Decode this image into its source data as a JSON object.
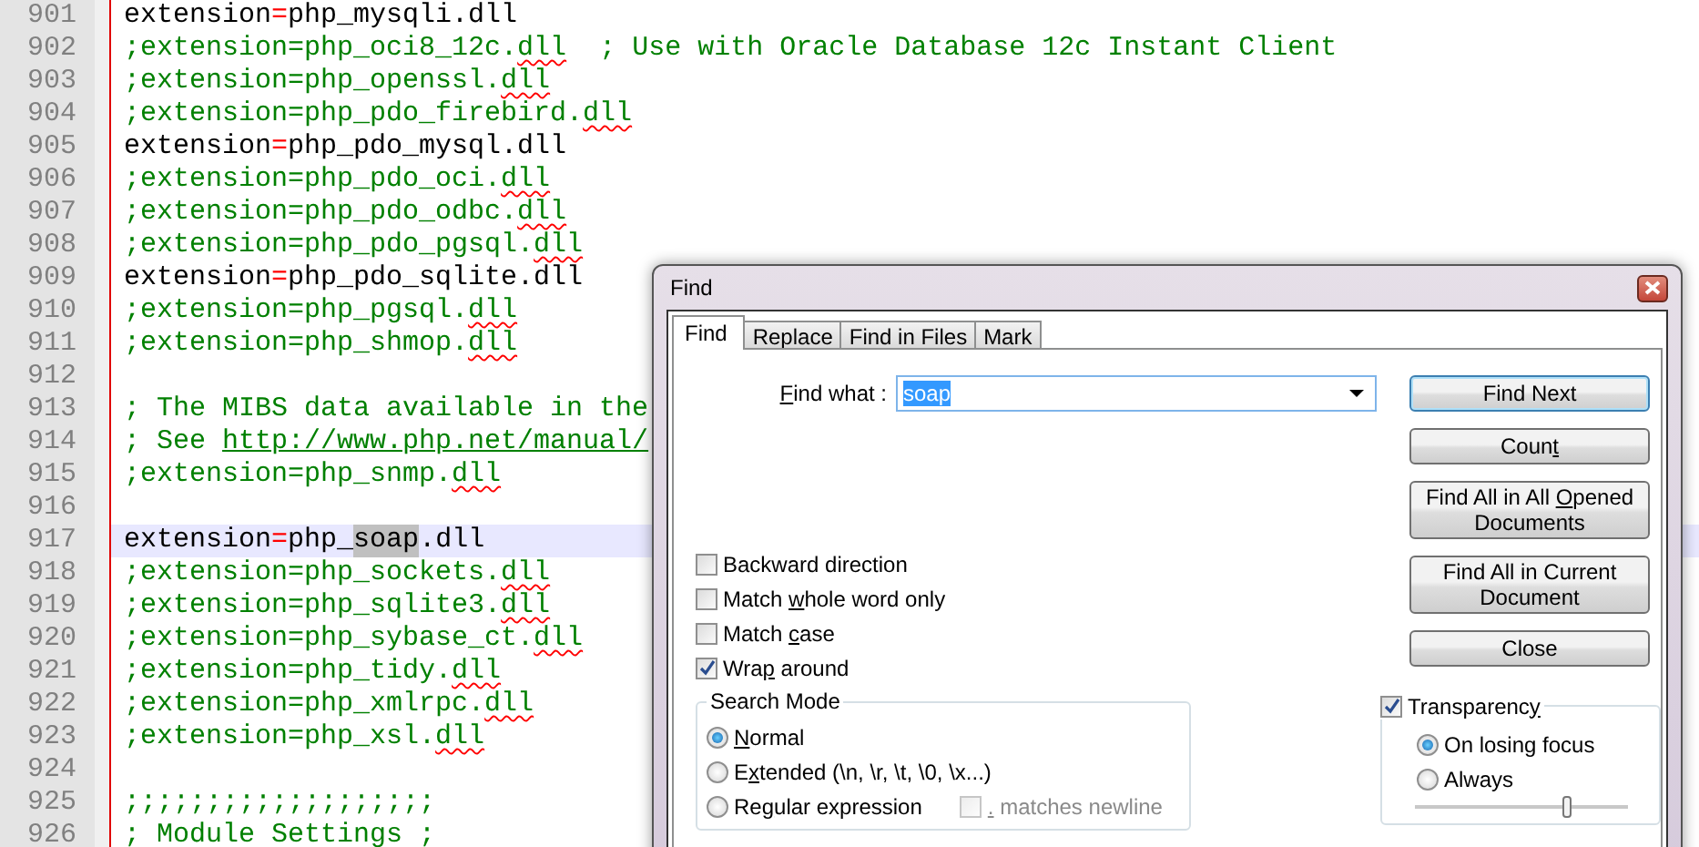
{
  "editor": {
    "lines": [
      {
        "number": "901",
        "kind": "directive",
        "current": false,
        "parts": [
          {
            "text": "extension",
            "kind": "plain"
          },
          {
            "text": "=",
            "kind": "operator"
          },
          {
            "text": "php_mysqli.dll",
            "kind": "plain"
          }
        ]
      },
      {
        "number": "902",
        "kind": "comment",
        "current": false,
        "parts": [
          {
            "text": ";extension=php_oci8_12c.",
            "kind": "plain"
          },
          {
            "text": "dll",
            "kind": "misspelled"
          },
          {
            "text": "  ; Use with Oracle Database 12c Instant Client",
            "kind": "plain"
          }
        ]
      },
      {
        "number": "903",
        "kind": "comment",
        "current": false,
        "parts": [
          {
            "text": ";extension=php_openssl.",
            "kind": "plain"
          },
          {
            "text": "dll",
            "kind": "misspelled"
          }
        ]
      },
      {
        "number": "904",
        "kind": "comment",
        "current": false,
        "parts": [
          {
            "text": ";extension=php_pdo_firebird.",
            "kind": "plain"
          },
          {
            "text": "dll",
            "kind": "misspelled"
          }
        ]
      },
      {
        "number": "905",
        "kind": "directive",
        "current": false,
        "parts": [
          {
            "text": "extension",
            "kind": "plain"
          },
          {
            "text": "=",
            "kind": "operator"
          },
          {
            "text": "php_pdo_mysql.dll",
            "kind": "plain"
          }
        ]
      },
      {
        "number": "906",
        "kind": "comment",
        "current": false,
        "parts": [
          {
            "text": ";extension=php_pdo_oci.",
            "kind": "plain"
          },
          {
            "text": "dll",
            "kind": "misspelled"
          }
        ]
      },
      {
        "number": "907",
        "kind": "comment",
        "current": false,
        "parts": [
          {
            "text": ";extension=php_pdo_odbc.",
            "kind": "plain"
          },
          {
            "text": "dll",
            "kind": "misspelled"
          }
        ]
      },
      {
        "number": "908",
        "kind": "comment",
        "current": false,
        "parts": [
          {
            "text": ";extension=php_pdo_pgsql.",
            "kind": "plain"
          },
          {
            "text": "dll",
            "kind": "misspelled"
          }
        ]
      },
      {
        "number": "909",
        "kind": "directive",
        "current": false,
        "parts": [
          {
            "text": "extension",
            "kind": "plain"
          },
          {
            "text": "=",
            "kind": "operator"
          },
          {
            "text": "php_pdo_sqlite.dll",
            "kind": "plain"
          }
        ]
      },
      {
        "number": "910",
        "kind": "comment",
        "current": false,
        "parts": [
          {
            "text": ";extension=php_pgsql.",
            "kind": "plain"
          },
          {
            "text": "dll",
            "kind": "misspelled"
          }
        ]
      },
      {
        "number": "911",
        "kind": "comment",
        "current": false,
        "parts": [
          {
            "text": ";extension=php_shmop.",
            "kind": "plain"
          },
          {
            "text": "dll",
            "kind": "misspelled"
          }
        ]
      },
      {
        "number": "912",
        "kind": "blank",
        "current": false
      },
      {
        "number": "913",
        "kind": "comment",
        "current": false,
        "parts": [
          {
            "text": "; The MIBS data available in the",
            "kind": "plain"
          }
        ]
      },
      {
        "number": "914",
        "kind": "comment",
        "current": false,
        "parts": [
          {
            "text": "; See ",
            "kind": "plain"
          },
          {
            "text": "http://www.php.net/manual/",
            "kind": "link"
          }
        ]
      },
      {
        "number": "915",
        "kind": "comment",
        "current": false,
        "parts": [
          {
            "text": ";extension=php_snmp.",
            "kind": "plain"
          },
          {
            "text": "dll",
            "kind": "misspelled"
          }
        ]
      },
      {
        "number": "916",
        "kind": "blank",
        "current": false
      },
      {
        "number": "917",
        "kind": "directive",
        "current": true,
        "parts": [
          {
            "text": "extension",
            "kind": "plain"
          },
          {
            "text": "=",
            "kind": "operator"
          },
          {
            "text": "php_",
            "kind": "plain"
          },
          {
            "text": "soap",
            "kind": "match"
          },
          {
            "text": ".dll",
            "kind": "plain"
          }
        ]
      },
      {
        "number": "918",
        "kind": "comment",
        "current": false,
        "parts": [
          {
            "text": ";extension=php_sockets.",
            "kind": "plain"
          },
          {
            "text": "dll",
            "kind": "misspelled"
          }
        ]
      },
      {
        "number": "919",
        "kind": "comment",
        "current": false,
        "parts": [
          {
            "text": ";extension=php_sqlite3.",
            "kind": "plain"
          },
          {
            "text": "dll",
            "kind": "misspelled"
          }
        ]
      },
      {
        "number": "920",
        "kind": "comment",
        "current": false,
        "parts": [
          {
            "text": ";extension=php_sybase_ct.",
            "kind": "plain"
          },
          {
            "text": "dll",
            "kind": "misspelled"
          }
        ]
      },
      {
        "number": "921",
        "kind": "comment",
        "current": false,
        "parts": [
          {
            "text": ";extension=php_tidy.",
            "kind": "plain"
          },
          {
            "text": "dll",
            "kind": "misspelled"
          }
        ]
      },
      {
        "number": "922",
        "kind": "comment",
        "current": false,
        "parts": [
          {
            "text": ";extension=php_xmlrpc.",
            "kind": "plain"
          },
          {
            "text": "dll",
            "kind": "misspelled"
          }
        ]
      },
      {
        "number": "923",
        "kind": "comment",
        "current": false,
        "parts": [
          {
            "text": ";extension=php_xsl.",
            "kind": "plain"
          },
          {
            "text": "dll",
            "kind": "misspelled"
          }
        ]
      },
      {
        "number": "924",
        "kind": "blank",
        "current": false
      },
      {
        "number": "925",
        "kind": "comment",
        "current": false,
        "parts": [
          {
            "text": ";;;;;;;;;;;;;;;;;;;",
            "kind": "plain"
          }
        ]
      },
      {
        "number": "926",
        "kind": "comment",
        "current": false,
        "parts": [
          {
            "text": "; Module Settings ;",
            "kind": "plain"
          }
        ]
      }
    ]
  },
  "find_dialog": {
    "title": "Find",
    "tabs": [
      {
        "label": "Find",
        "selected": true
      },
      {
        "label": "Replace",
        "selected": false
      },
      {
        "label": "Find in Files",
        "selected": false
      },
      {
        "label": "Mark",
        "selected": false
      }
    ],
    "find_what": {
      "access_key": "F",
      "label_after": "ind what :",
      "value": "soap"
    },
    "buttons": [
      {
        "label": "Find Next",
        "default": true
      },
      {
        "label_before": "Coun",
        "access_key": "t",
        "default": false
      },
      {
        "label_before": "Find All in All ",
        "access_key": "O",
        "label_after": "pened Documents",
        "default": false
      },
      {
        "label": "Find All in Current Document",
        "default": false
      },
      {
        "label": "Close",
        "default": false
      }
    ],
    "options": [
      {
        "label": "Backward direction",
        "checked": false
      },
      {
        "label_before": "Match ",
        "access_key": "w",
        "label_after": "hole word only",
        "checked": false
      },
      {
        "label_before": "Match ",
        "access_key": "c",
        "label_after": "ase",
        "checked": false
      },
      {
        "label_before": "Wra",
        "access_key": "p",
        "label_after": " around",
        "checked": true
      }
    ],
    "search_mode": {
      "title": "Search Mode",
      "modes": [
        {
          "access_key": "N",
          "label_after": "ormal",
          "selected": true
        },
        {
          "label_before": "E",
          "access_key": "x",
          "label_after": "tended (\\n, \\r, \\t, \\0, \\x...)",
          "selected": false
        },
        {
          "label_before": "Re",
          "access_key": "g",
          "label_after": "ular expression",
          "selected": false
        }
      ],
      "matches_newline": {
        "access_key": ".",
        "label_after": " matches newline",
        "checked": false,
        "disabled": true
      }
    },
    "transparency": {
      "label_before": "Transparenc",
      "access_key": "y",
      "checked": true,
      "modes": [
        {
          "label": "On losing focus",
          "selected": true
        },
        {
          "label": "Always",
          "selected": false
        }
      ],
      "level": 0.72
    }
  }
}
